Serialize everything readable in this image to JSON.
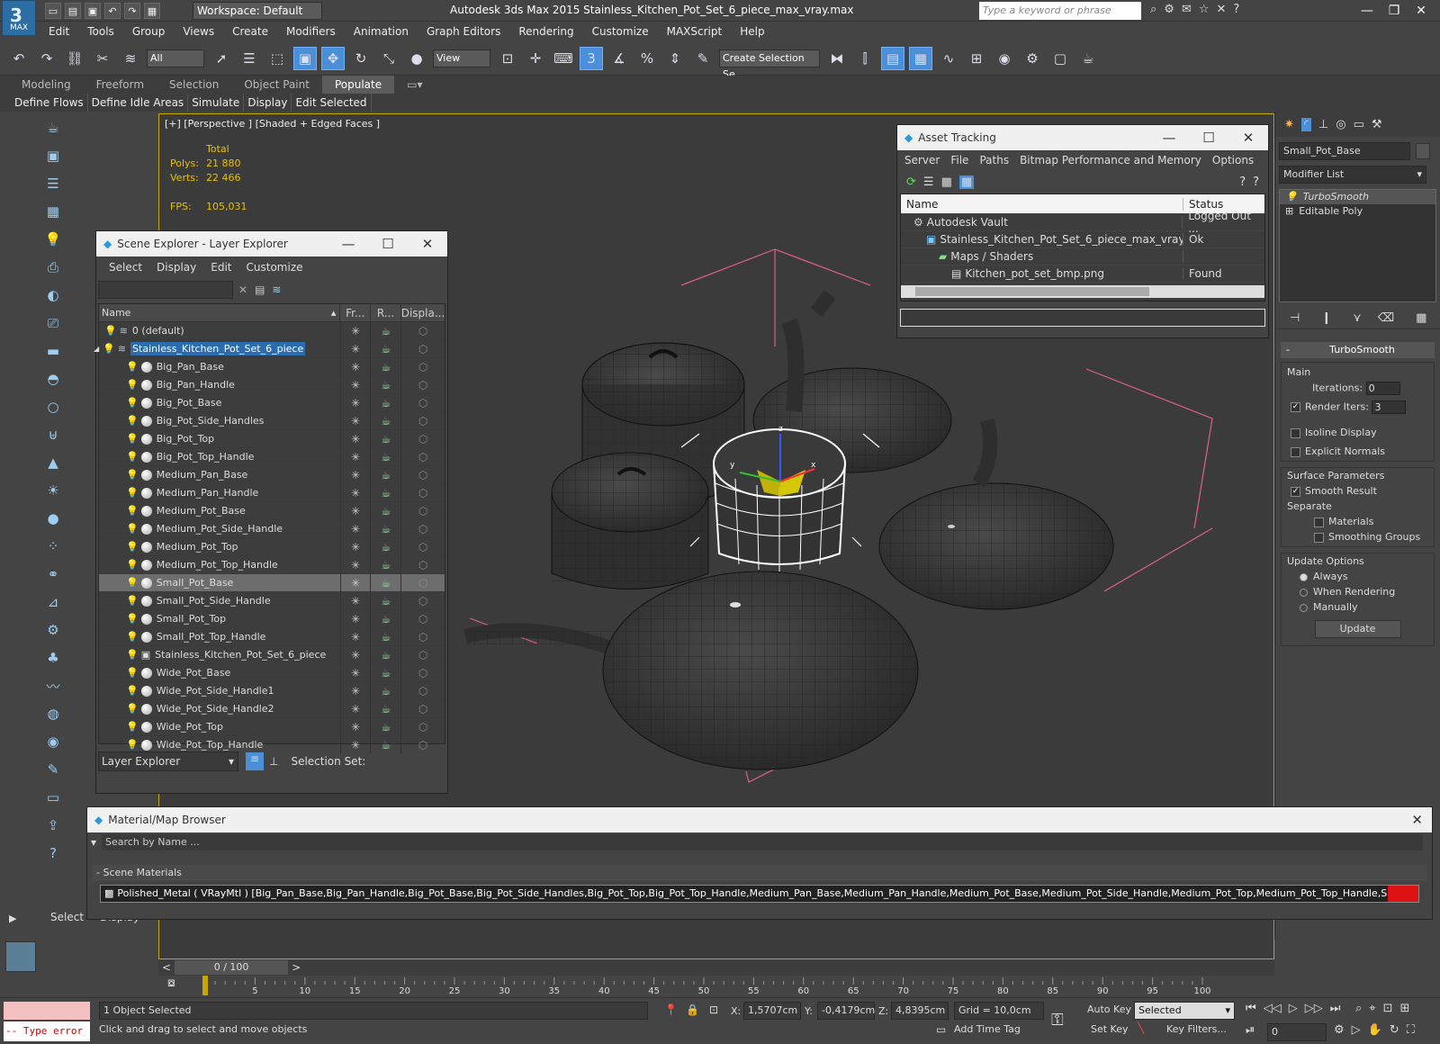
{
  "app": {
    "logo_text": "MAX",
    "logo_glyph": "3",
    "workspace": "Workspace: Default",
    "title": "Autodesk 3ds Max  2015    Stainless_Kitchen_Pot_Set_6_piece_max_vray.max",
    "search_placeholder": "Type a keyword or phrase"
  },
  "menu": [
    "Edit",
    "Tools",
    "Group",
    "Views",
    "Create",
    "Modifiers",
    "Animation",
    "Graph Editors",
    "Rendering",
    "Customize",
    "MAXScript",
    "Help"
  ],
  "toolbar": {
    "filter": "All",
    "view": "View",
    "snap_label": "3",
    "selection_set_placeholder": "Create Selection Se"
  },
  "ribbon": {
    "tabs": [
      "Modeling",
      "Freeform",
      "Selection",
      "Object Paint",
      "Populate"
    ],
    "active_tab": "Populate",
    "buttons": [
      "Define Flows",
      "Define Idle Areas",
      "Simulate",
      "Display",
      "Edit Selected"
    ]
  },
  "viewport": {
    "label": "[+] [Perspective ] [Shaded + Edged Faces ]",
    "stats_header": "Total",
    "polys_label": "Polys:",
    "polys": "21 880",
    "verts_label": "Verts:",
    "verts": "22 466",
    "fps_label": "FPS:",
    "fps": "105,031",
    "gizmo_x": "x",
    "gizmo_y": "y",
    "gizmo_z": "z"
  },
  "scene_explorer": {
    "title": "Scene Explorer - Layer Explorer",
    "menu": [
      "Select",
      "Display",
      "Edit",
      "Customize"
    ],
    "columns": [
      "Name",
      "Fr...",
      "R...",
      "Displa..."
    ],
    "rows": [
      {
        "name": "0 (default)",
        "type": "layer",
        "indent": 1
      },
      {
        "name": "Stainless_Kitchen_Pot_Set_6_piece",
        "type": "layer",
        "indent": 1,
        "selected": true
      },
      {
        "name": "Big_Pan_Base",
        "type": "object",
        "indent": 2
      },
      {
        "name": "Big_Pan_Handle",
        "type": "object",
        "indent": 2
      },
      {
        "name": "Big_Pot_Base",
        "type": "object",
        "indent": 2
      },
      {
        "name": "Big_Pot_Side_Handles",
        "type": "object",
        "indent": 2
      },
      {
        "name": "Big_Pot_Top",
        "type": "object",
        "indent": 2
      },
      {
        "name": "Big_Pot_Top_Handle",
        "type": "object",
        "indent": 2
      },
      {
        "name": "Medium_Pan_Base",
        "type": "object",
        "indent": 2
      },
      {
        "name": "Medium_Pan_Handle",
        "type": "object",
        "indent": 2
      },
      {
        "name": "Medium_Pot_Base",
        "type": "object",
        "indent": 2
      },
      {
        "name": "Medium_Pot_Side_Handle",
        "type": "object",
        "indent": 2
      },
      {
        "name": "Medium_Pot_Top",
        "type": "object",
        "indent": 2
      },
      {
        "name": "Medium_Pot_Top_Handle",
        "type": "object",
        "indent": 2
      },
      {
        "name": "Small_Pot_Base",
        "type": "object",
        "indent": 2,
        "highlighted": true
      },
      {
        "name": "Small_Pot_Side_Handle",
        "type": "object",
        "indent": 2
      },
      {
        "name": "Small_Pot_Top",
        "type": "object",
        "indent": 2
      },
      {
        "name": "Small_Pot_Top_Handle",
        "type": "object",
        "indent": 2
      },
      {
        "name": "Stainless_Kitchen_Pot_Set_6_piece",
        "type": "group",
        "indent": 2
      },
      {
        "name": "Wide_Pot_Base",
        "type": "object",
        "indent": 2
      },
      {
        "name": "Wide_Pot_Side_Handle1",
        "type": "object",
        "indent": 2
      },
      {
        "name": "Wide_Pot_Side_Handle2",
        "type": "object",
        "indent": 2
      },
      {
        "name": "Wide_Pot_Top",
        "type": "object",
        "indent": 2
      },
      {
        "name": "Wide_Pot_Top_Handle",
        "type": "object",
        "indent": 2
      }
    ],
    "footer_mode": "Layer Explorer",
    "selection_set_label": "Selection Set:"
  },
  "asset_tracking": {
    "title": "Asset Tracking",
    "menu": [
      "Server",
      "File",
      "Paths",
      "Bitmap Performance and Memory",
      "Options"
    ],
    "columns": [
      "Name",
      "Status"
    ],
    "rows": [
      {
        "name": "Autodesk Vault",
        "status": "Logged Out ...",
        "indent": 1
      },
      {
        "name": "Stainless_Kitchen_Pot_Set_6_piece_max_vray.max",
        "status": "Ok",
        "indent": 2
      },
      {
        "name": "Maps / Shaders",
        "status": "",
        "indent": 3
      },
      {
        "name": "Kitchen_pot_set_bmp.png",
        "status": "Found",
        "indent": 4
      }
    ]
  },
  "command_panel": {
    "object_name": "Small_Pot_Base",
    "modifier_list": "Modifier List",
    "stack": [
      "TurboSmooth",
      "Editable Poly"
    ],
    "rollout_title": "TurboSmooth",
    "main_label": "Main",
    "iterations_label": "Iterations:",
    "iterations": "0",
    "render_iters_label": "Render Iters:",
    "render_iters": "3",
    "isoline": "Isoline Display",
    "explicit_normals": "Explicit Normals",
    "surface_params": "Surface Parameters",
    "smooth_result": "Smooth Result",
    "separate": "Separate",
    "materials": "Materials",
    "smoothing_groups": "Smoothing Groups",
    "update_options": "Update Options",
    "always": "Always",
    "when_rendering": "When Rendering",
    "manually": "Manually",
    "update_button": "Update"
  },
  "material_browser": {
    "title": "Material/Map Browser",
    "search_placeholder": "Search by Name ...",
    "section": "- Scene Materials",
    "material": "Polished_Metal ( VRayMtl ) [Big_Pan_Base,Big_Pan_Handle,Big_Pot_Base,Big_Pot_Side_Handles,Big_Pot_Top,Big_Pot_Top_Handle,Medium_Pan_Base,Medium_Pan_Handle,Medium_Pot_Base,Medium_Pot_Side_Handle,Medium_Pot_Top,Medium_Pot_Top_Handle,Small_Pot..."
  },
  "left_panel": {
    "select": "Select",
    "display": "Display"
  },
  "timeline": {
    "frame": "0 / 100",
    "ticks": [
      "0",
      "5",
      "10",
      "15",
      "20",
      "25",
      "30",
      "35",
      "40",
      "45",
      "50",
      "55",
      "60",
      "65",
      "70",
      "75",
      "80",
      "85",
      "90",
      "95",
      "100"
    ]
  },
  "status": {
    "script_error": "-- Type error",
    "selected": "1 Object Selected",
    "prompt": "Click and drag to select and move objects",
    "x_label": "X:",
    "x": "1,5707cm",
    "y_label": "Y:",
    "y": "-0,4179cm",
    "z_label": "Z:",
    "z": "4,8395cm",
    "grid": "Grid = 10,0cm",
    "add_time_tag": "Add Time Tag",
    "auto_key": "Auto Key",
    "set_key": "Set Key",
    "key_mode": "Selected",
    "key_filters": "Key Filters...",
    "frame_field": "0"
  },
  "colors": {
    "accent": "#2b6cb0",
    "viewport_border": "#c8a600",
    "stats": "#e8c000"
  }
}
